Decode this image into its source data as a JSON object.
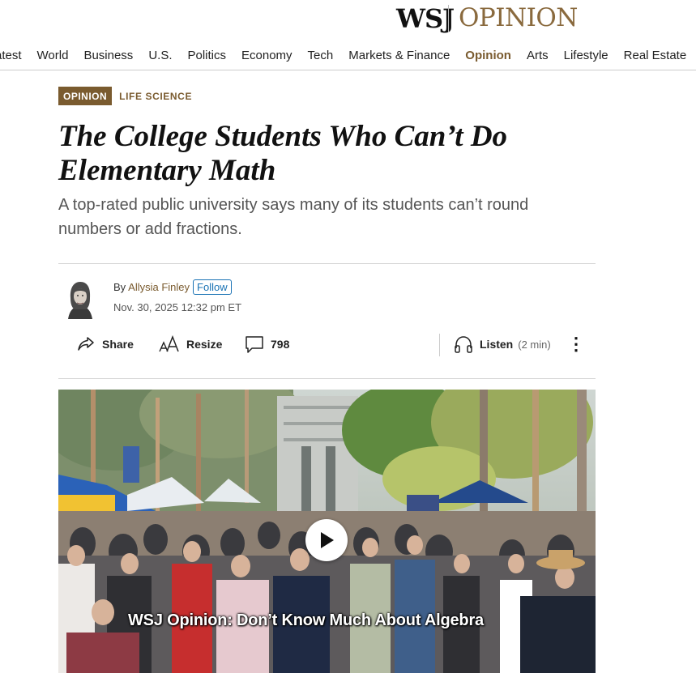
{
  "masthead": {
    "brand": "WSJ",
    "section": "OPINION"
  },
  "nav": {
    "items": [
      "atest",
      "World",
      "Business",
      "U.S.",
      "Politics",
      "Economy",
      "Tech",
      "Markets & Finance",
      "Opinion",
      "Arts",
      "Lifestyle",
      "Real Estate"
    ],
    "active": "Opinion"
  },
  "flashline": {
    "badge": "OPINION",
    "section": "LIFE SCIENCE"
  },
  "article": {
    "headline_line1": "The College Students Who Can’t Do",
    "headline_line2": "Elementary Math",
    "dek": "A top-rated public university says many of its students can’t round numbers or add fractions."
  },
  "byline": {
    "prefix": "By",
    "author": "Allysia Finley",
    "follow_label": "Follow",
    "timestamp": "Nov. 30, 2025 12:32 pm ET"
  },
  "toolbar": {
    "share_label": "Share",
    "resize_label": "Resize",
    "comments_count": "798",
    "listen_label": "Listen",
    "listen_duration": "(2 min)",
    "more_label": "⋮"
  },
  "video": {
    "caption": "WSJ Opinion: Don’t Know Much About Algebra",
    "icon": "play-icon"
  },
  "colors": {
    "accent": "#7a5b2f",
    "link": "#1a73b5",
    "logo_opinion": "#8a6a3e"
  }
}
